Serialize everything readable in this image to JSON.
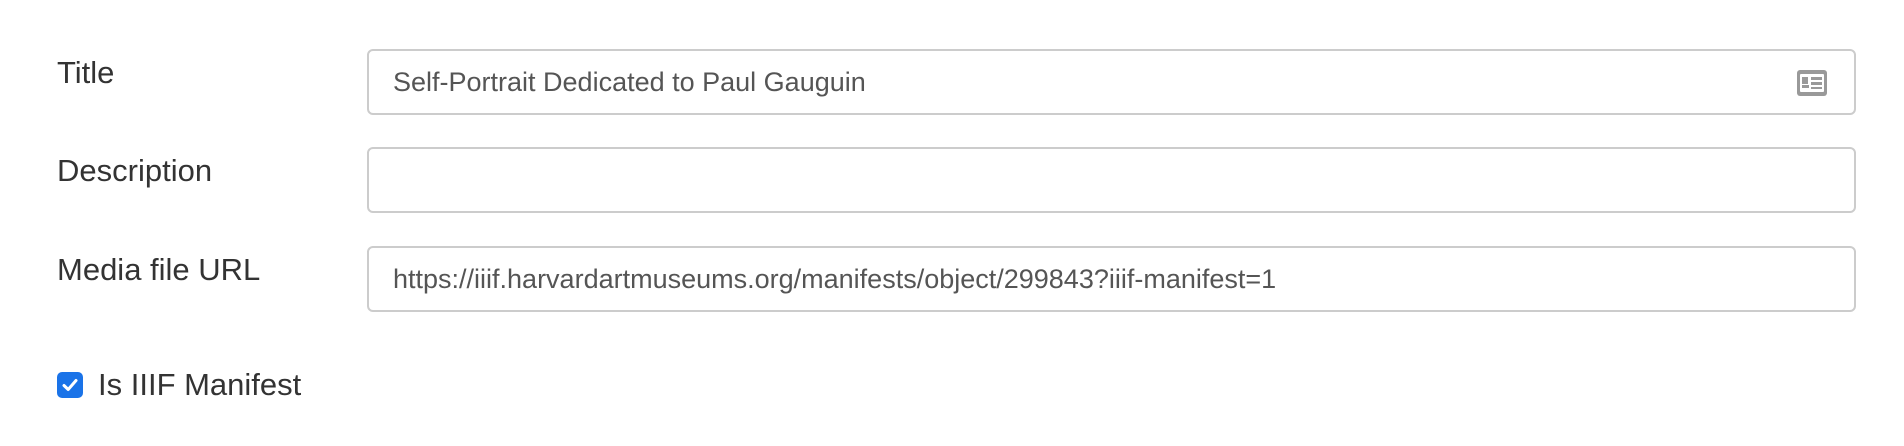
{
  "form": {
    "title": {
      "label": "Title",
      "value": "Self-Portrait Dedicated to Paul Gauguin",
      "icon": "id-card-icon"
    },
    "description": {
      "label": "Description",
      "value": ""
    },
    "media_url": {
      "label": "Media file URL",
      "value": "https://iiif.harvardartmuseums.org/manifests/object/299843?iiif-manifest=1"
    },
    "iiif_checkbox": {
      "label": "Is IIIF Manifest",
      "checked": true
    }
  },
  "colors": {
    "accent": "#1a73e8",
    "border": "#cccccc",
    "text": "#333333",
    "icon": "#999999"
  }
}
